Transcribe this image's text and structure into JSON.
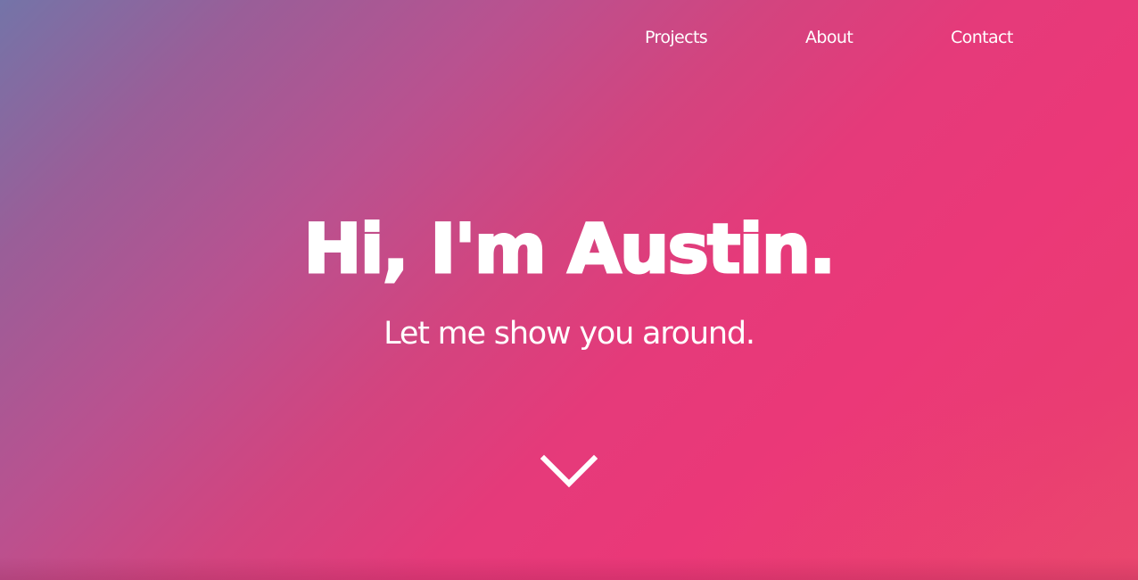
{
  "nav": {
    "items": [
      {
        "label": "Projects"
      },
      {
        "label": "About"
      },
      {
        "label": "Contact"
      }
    ]
  },
  "hero": {
    "headline": "Hi, I'm Austin.",
    "subheadline": "Let me show you around.",
    "scroll_icon": "chevron-down-icon"
  },
  "colors": {
    "gradient_start": "#7474a8",
    "gradient_mid": "#d3447f",
    "gradient_end": "#eb3878",
    "text": "#ffffff"
  }
}
